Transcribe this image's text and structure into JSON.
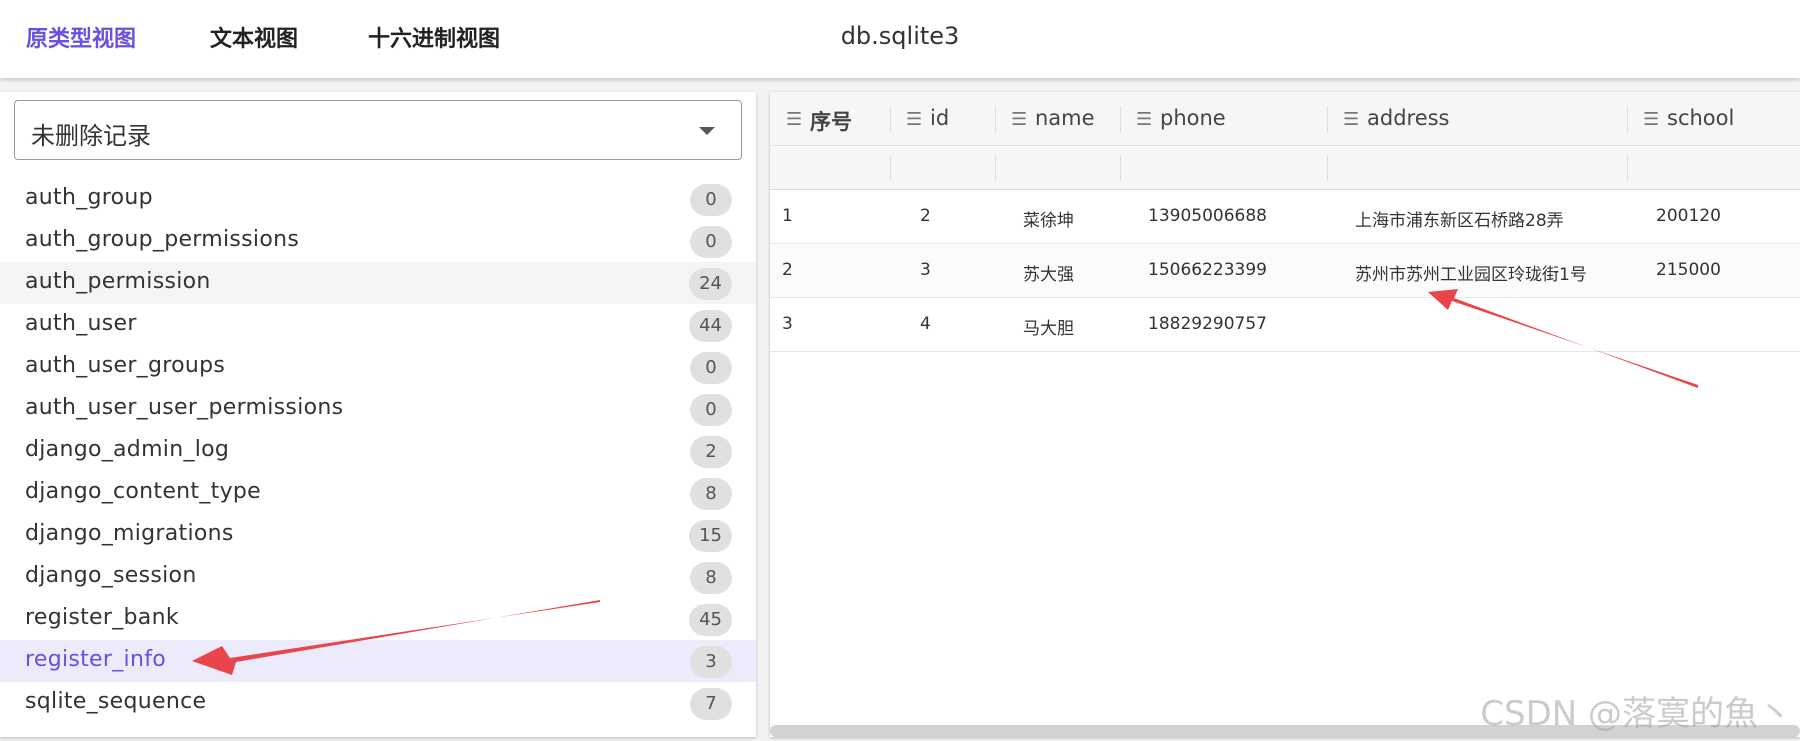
{
  "tabs": [
    {
      "label": "原类型视图",
      "active": true
    },
    {
      "label": "文本视图",
      "active": false
    },
    {
      "label": "十六进制视图",
      "active": false
    }
  ],
  "file_title": "db.sqlite3",
  "filter_select": {
    "value": "未删除记录"
  },
  "tables": [
    {
      "name": "auth_group",
      "count": "0"
    },
    {
      "name": "auth_group_permissions",
      "count": "0"
    },
    {
      "name": "auth_permission",
      "count": "24"
    },
    {
      "name": "auth_user",
      "count": "44"
    },
    {
      "name": "auth_user_groups",
      "count": "0"
    },
    {
      "name": "auth_user_user_permissions",
      "count": "0"
    },
    {
      "name": "django_admin_log",
      "count": "2"
    },
    {
      "name": "django_content_type",
      "count": "8"
    },
    {
      "name": "django_migrations",
      "count": "15"
    },
    {
      "name": "django_session",
      "count": "8"
    },
    {
      "name": "register_bank",
      "count": "45"
    },
    {
      "name": "register_info",
      "count": "3"
    },
    {
      "name": "sqlite_sequence",
      "count": "7"
    }
  ],
  "grid": {
    "columns": [
      "序号",
      "id",
      "name",
      "phone",
      "address",
      "school"
    ],
    "rows": [
      [
        "1",
        "2",
        "菜徐坤",
        "13905006688",
        "上海市浦东新区石桥路28弄",
        "200120"
      ],
      [
        "2",
        "3",
        "苏大强",
        "15066223399",
        "苏州市苏州工业园区玲珑街1号",
        "215000"
      ],
      [
        "3",
        "4",
        "马大胆",
        "18829290757",
        "",
        ""
      ]
    ]
  },
  "watermark": "CSDN @落寞的魚丶",
  "colors": {
    "accent": "#6a4fe0",
    "arrow": "#e8464a"
  }
}
